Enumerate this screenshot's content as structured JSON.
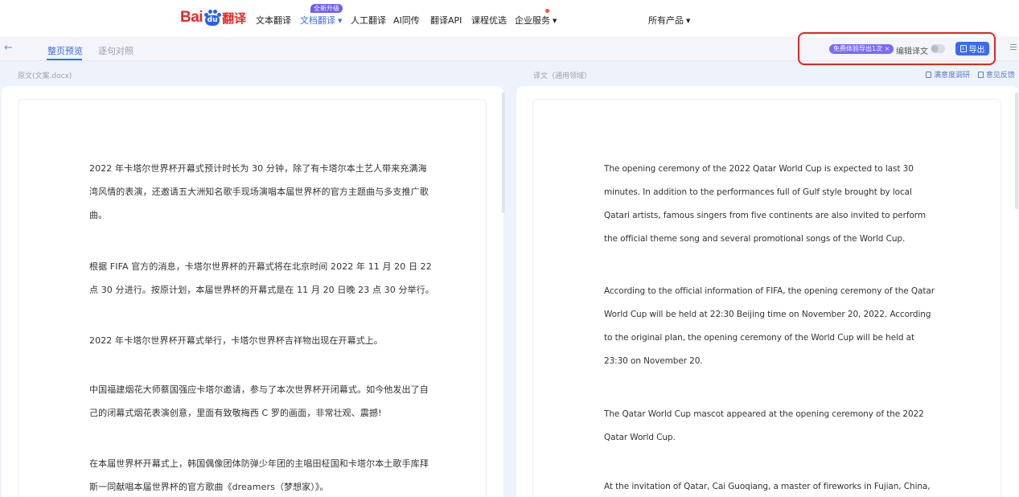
{
  "header": {
    "logo": {
      "bai": "Bai",
      "du": "du",
      "yi": "翻译"
    },
    "nav": [
      {
        "label": "文本翻译"
      },
      {
        "label": "文档翻译",
        "active": true
      },
      {
        "label": "人工翻译"
      },
      {
        "label": "AI同传"
      },
      {
        "label": "翻译API"
      },
      {
        "label": "课程优选"
      },
      {
        "label": "企业服务"
      },
      {
        "label": "所有产品"
      }
    ],
    "new_badge": "全新升级"
  },
  "tabs": [
    {
      "label": "整页预览",
      "active": true
    },
    {
      "label": "逐句对照"
    }
  ],
  "toolbar": {
    "trial_badge": "免费体验导出1次 ×",
    "edit_label": "编辑译文",
    "export_label": "导出",
    "export_icon": "export-icon",
    "menu_icon": "list-menu-icon",
    "back_icon": "back-arrow-icon"
  },
  "source": {
    "label": "原文(文案.docx)",
    "paragraphs": [
      "2022 年卡塔尔世界杯开幕式预计时长为 30 分钟，除了有卡塔尔本土艺人带来充满海湾风情的表演，还邀请五大洲知名歌手现场演唱本届世界杯的官方主题曲与多支推广歌曲。",
      "根据 FIFA 官方的消息，卡塔尔世界杯的开幕式将在北京时间 2022 年 11 月 20 日 22 点 30 分进行。按原计划，本届世界杯的开幕式是在 11 月 20 日晚 23 点 30 分举行。",
      "2022 年卡塔尔世界杯开幕式举行，卡塔尔世界杯吉祥物出现在开幕式上。",
      "中国福建烟花大师蔡国强应卡塔尔邀请，参与了本次世界杯开闭幕式。如今他发出了自己的闭幕式烟花表演创意，里面有致敬梅西 C 罗的画面，非常壮观、震撼!",
      "在本届世界杯开幕式上，韩国偶像团体防弹少年团的主唱田柾国和卡塔尔本土歌手库拜斯一同献唱本届世界杯的官方歌曲《dreamers（梦想家）》。"
    ]
  },
  "translation": {
    "label": "译文（通用领域）",
    "links": [
      "满意度调研",
      "意见反馈"
    ],
    "paragraphs": [
      "The opening ceremony of the 2022 Qatar World Cup is expected to last 30 minutes. In addition to the performances full of Gulf style brought by local Qatari artists, famous singers from five continents are also invited to perform the official theme song and several promotional songs of the World Cup.",
      "According to the official information of FIFA, the opening ceremony of the Qatar World Cup will be held at 22:30 Beijing time on November 20, 2022. According to the original plan, the opening ceremony of the World Cup will be held at 23:30 on November 20.",
      "The Qatar World Cup mascot appeared at the opening ceremony of the 2022 Qatar World Cup.",
      "At the invitation of Qatar, Cai Guoqiang, a master of fireworks in Fujian, China,"
    ]
  }
}
